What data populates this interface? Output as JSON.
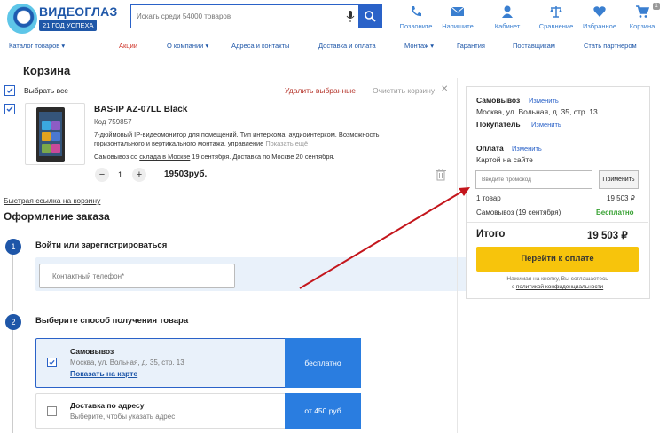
{
  "brand": {
    "name": "ВИДЕОГЛАЗ",
    "tagline": "21 ГОД УСПЕХА"
  },
  "search": {
    "placeholder": "Искать среди 54000 товаров"
  },
  "header_icons": [
    {
      "label": "Позвоните",
      "icon": "phone-icon"
    },
    {
      "label": "Напишите",
      "icon": "mail-icon"
    },
    {
      "label": "Кабинет",
      "icon": "user-icon"
    },
    {
      "label": "Сравнение",
      "icon": "scales-icon"
    },
    {
      "label": "Избранное",
      "icon": "heart-icon"
    },
    {
      "label": "Корзина",
      "icon": "cart-icon",
      "badge": "1"
    }
  ],
  "nav": [
    {
      "label": "Каталог товаров ▾"
    },
    {
      "label": "Акции"
    },
    {
      "label": "О компании ▾"
    },
    {
      "label": "Адреса и контакты"
    },
    {
      "label": "Доставка и оплата"
    },
    {
      "label": "Монтаж ▾"
    },
    {
      "label": "Гарантия"
    },
    {
      "label": "Поставщикам"
    },
    {
      "label": "Стать партнером"
    }
  ],
  "cart": {
    "title": "Корзина",
    "select_all": "Выбрать все",
    "delete_selected": "Удалить выбранные",
    "clear_cart": "Очистить корзину",
    "product": {
      "name": "BAS-IP AZ-07LL Black",
      "code": "Код 759857",
      "description": "7-дюймовый IP-видеомонитор для помещений. Тип интеркома: аудиоинтерком. Возможность горизонтального и вертикального монтажа, управление",
      "show_more": "Показать ещё",
      "availability_prefix": "Самовывоз со ",
      "availability_link": "склада в Москве",
      "availability_suffix": " 19 сентября. Доставка по Москве 20 сентября.",
      "quantity": "1",
      "price": "19503руб."
    },
    "quick_link": "Быстрая ссылка на корзину"
  },
  "checkout": {
    "title": "Оформление заказа",
    "step1": {
      "num": "1",
      "title": "Войти или зарегистрироваться",
      "phone_placeholder": "Контактный телефон*"
    },
    "step2": {
      "num": "2",
      "title": "Выберите способ получения товара"
    },
    "options": [
      {
        "title": "Самовывоз",
        "address": "Москва, ул. Вольная, д. 35, стр. 13",
        "link": "Показать на карте",
        "price": "бесплатно",
        "selected": true
      },
      {
        "title": "Доставка по адресу",
        "address": "Выберите, чтобы указать адрес",
        "price": "от 450 руб",
        "selected": false
      }
    ]
  },
  "summary": {
    "pickup_label": "Самовывоз",
    "pickup_change": "Изменить",
    "pickup_address": "Москва, ул. Вольная, д. 35, стр. 13",
    "buyer_label": "Покупатель",
    "buyer_change": "Изменить",
    "payment_label": "Оплата",
    "payment_change": "Изменить",
    "payment_method": "Картой на сайте",
    "promo_placeholder": "Введите промокод",
    "apply": "Применить",
    "items_label": "1 товар",
    "items_value": "19 503 ₽",
    "delivery_label": "Самовывоз (19 сентября)",
    "delivery_value": "Бесплатно",
    "total_label": "Итого",
    "total_value": "19 503 ₽",
    "pay_button": "Перейти к оплате",
    "agreement_line1": "Нажимая на кнопку, Вы соглашаетесь",
    "agreement_prefix": "с ",
    "agreement_link": "политикой конфиденциальности"
  },
  "colors": {
    "accent": "#2a62c8",
    "arrow": "#c4161c",
    "pay": "#f7c40c",
    "free": "#3aa335"
  }
}
